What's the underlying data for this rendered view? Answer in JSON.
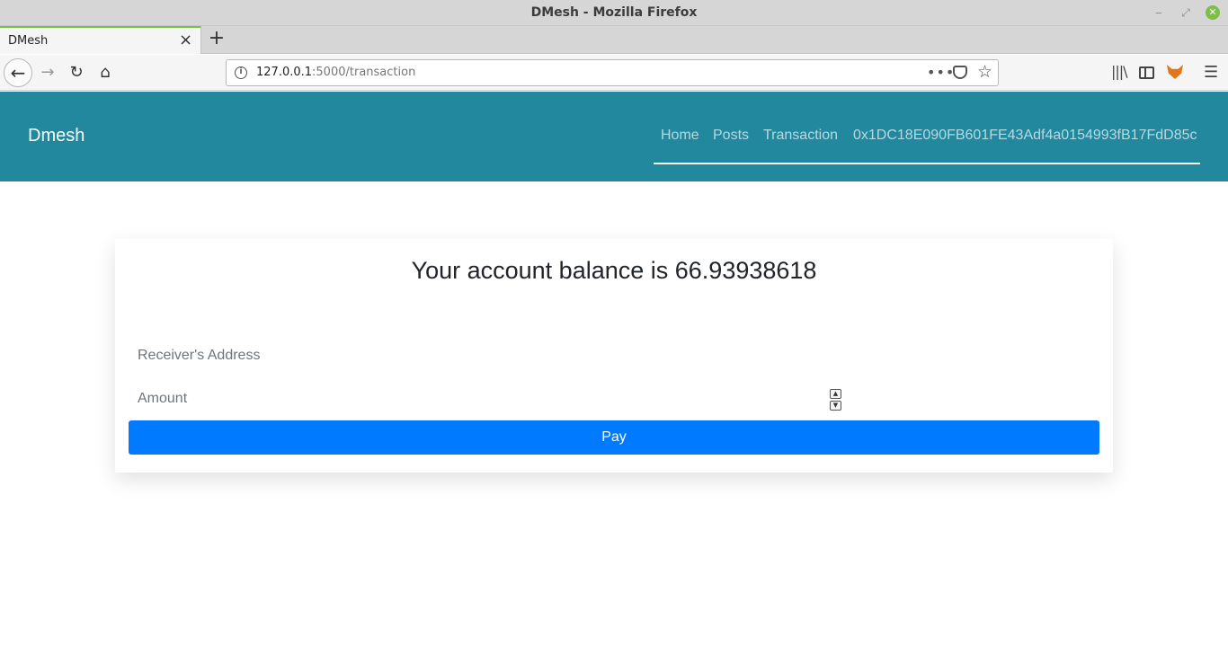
{
  "window": {
    "title": "DMesh - Mozilla Firefox",
    "controls": {
      "minimize": "‒",
      "maximize": "⤢",
      "close": "✕"
    }
  },
  "tabs": [
    {
      "label": "DMesh",
      "active": true
    }
  ],
  "browser": {
    "url_host": "127.0.0.1",
    "url_path": ":5000/transaction",
    "icons": [
      "back-icon",
      "forward-icon",
      "reload-icon",
      "home-icon",
      "info-icon",
      "more-icon",
      "pocket-icon",
      "bookmark-star-icon",
      "library-icon",
      "sidebar-icon",
      "metamask-fox-icon",
      "hamburger-menu-icon"
    ]
  },
  "site": {
    "brand": "Dmesh",
    "nav": {
      "home": "Home",
      "posts": "Posts",
      "transaction": "Transaction",
      "account": "0x1DC18E090FB601FE43Adf4a0154993fB17FdD85c"
    },
    "colors": {
      "header_bg": "#21889e",
      "primary_button": "#007bff"
    }
  },
  "transaction": {
    "balance_text": "Your account balance is 66.93938618",
    "receiver_placeholder": "Receiver's Address",
    "amount_placeholder": "Amount",
    "pay_label": "Pay"
  }
}
